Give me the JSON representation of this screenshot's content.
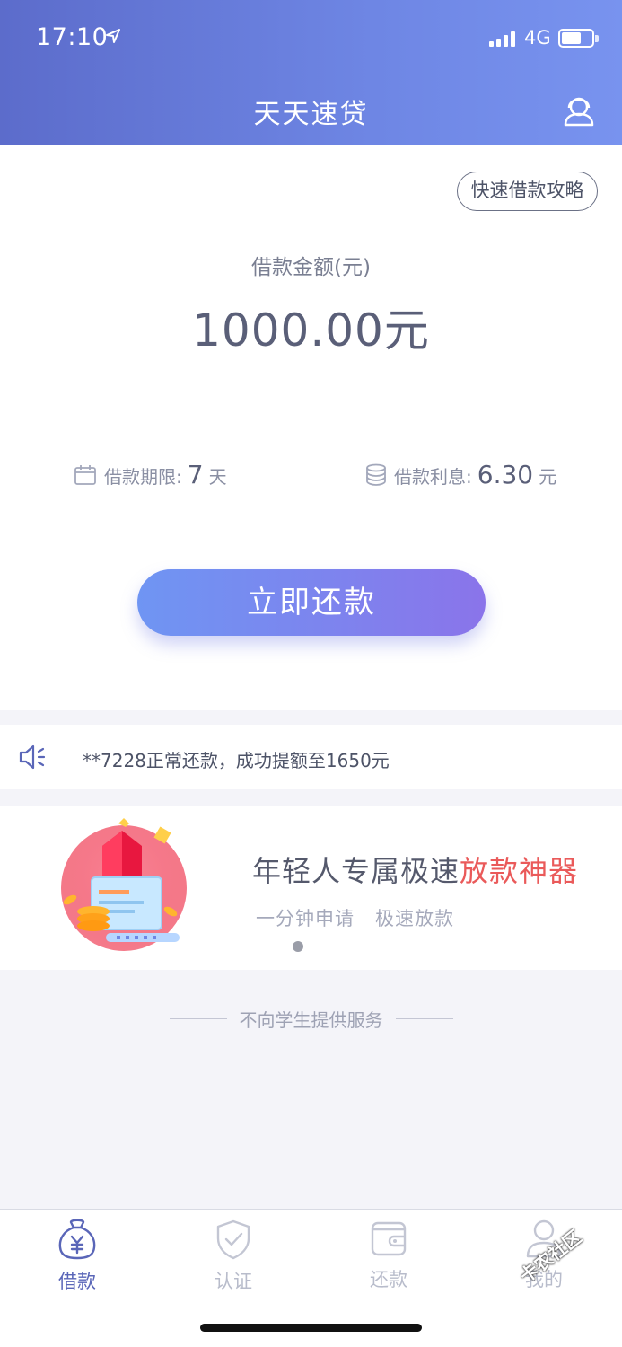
{
  "status_bar": {
    "time": "17:10",
    "network": "4G",
    "battery_level": 0.55,
    "signal_bars": 4
  },
  "header": {
    "title": "天天速贷",
    "support_icon": "customer-service-icon"
  },
  "loan": {
    "guide_button": "快速借款攻略",
    "amount_label": "借款金额(元)",
    "amount_value": "1000.00元",
    "term_label": "借款期限:",
    "term_value": "7",
    "term_unit": "天",
    "interest_label": "借款利息:",
    "interest_value": "6.30",
    "interest_unit": "元",
    "repay_button": "立即还款"
  },
  "notice": {
    "icon": "speaker-icon",
    "text": "**7228正常还款，成功提额至1650元"
  },
  "banner": {
    "title_main": "年轻人专属极速",
    "title_highlight": "放款神器",
    "subtitle": "一分钟申请   极速放款",
    "page_indicator_count": 1
  },
  "disclaimer": "不向学生提供服务",
  "tabbar": {
    "items": [
      {
        "label": "借款",
        "icon": "money-bag-icon",
        "active": true
      },
      {
        "label": "认证",
        "icon": "shield-check-icon",
        "active": false
      },
      {
        "label": "还款",
        "icon": "wallet-icon",
        "active": false
      },
      {
        "label": "我的",
        "icon": "user-icon",
        "active": false
      }
    ]
  },
  "watermark": "卡农社区",
  "colors": {
    "header_gradient_start": "#5c6ccb",
    "header_gradient_end": "#7893ef",
    "button_gradient_start": "#6f95f3",
    "button_gradient_end": "#8a74ea",
    "highlight_red": "#ea5a5a",
    "active_tab": "#5a66b8"
  }
}
